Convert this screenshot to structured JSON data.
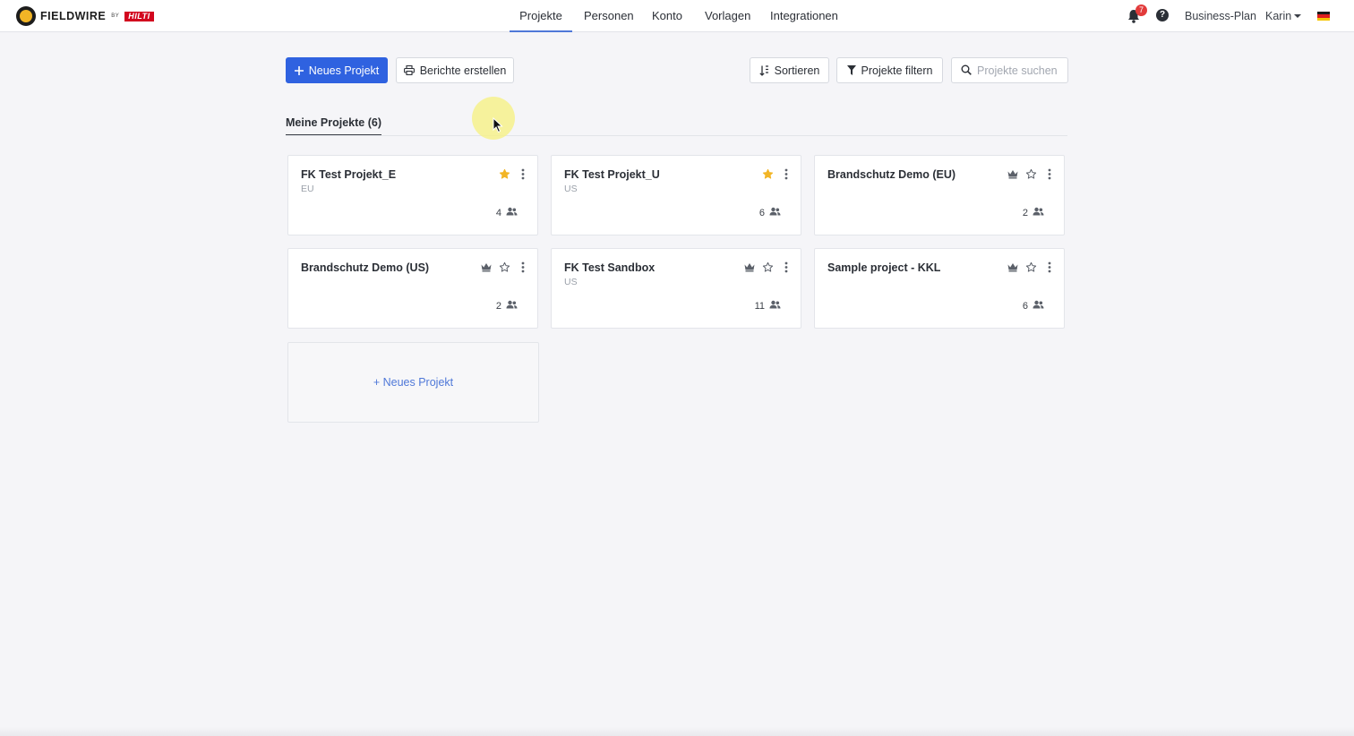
{
  "brand": {
    "name": "FIELDWIRE",
    "by": "BY",
    "partner": "HILTI"
  },
  "nav": {
    "items": [
      {
        "label": "Projekte",
        "active": true
      },
      {
        "label": "Personen",
        "active": false
      },
      {
        "label": "Konto",
        "active": false
      },
      {
        "label": "Vorlagen",
        "active": false
      },
      {
        "label": "Integrationen",
        "active": false
      }
    ]
  },
  "header_right": {
    "notifications_count": "7",
    "help_symbol": "?",
    "plan_label": "Business-Plan",
    "user_name": "Karin",
    "language_flag": "flag-de-icon"
  },
  "toolbar": {
    "new_project_label": "Neues Projekt",
    "reports_label": "Berichte erstellen",
    "sort_label": "Sortieren",
    "filter_label": "Projekte filtern",
    "search_placeholder": "Projekte suchen",
    "search_value": ""
  },
  "tabs": [
    {
      "label": "Meine Projekte (6)",
      "active": true
    }
  ],
  "projects": [
    {
      "name": "FK Test Projekt_E",
      "region": "EU",
      "users": "4",
      "starred": true,
      "owner_crown": false
    },
    {
      "name": "FK Test Projekt_U",
      "region": "US",
      "users": "6",
      "starred": true,
      "owner_crown": false
    },
    {
      "name": "Brandschutz Demo (EU)",
      "region": "",
      "users": "2",
      "starred": false,
      "owner_crown": true
    },
    {
      "name": "Brandschutz Demo (US)",
      "region": "",
      "users": "2",
      "starred": false,
      "owner_crown": true
    },
    {
      "name": "FK Test Sandbox",
      "region": "US",
      "users": "11",
      "starred": false,
      "owner_crown": true
    },
    {
      "name": "Sample project - KKL",
      "region": "",
      "users": "6",
      "starred": false,
      "owner_crown": true
    }
  ],
  "new_project_card_label": "+ Neues Projekt",
  "colors": {
    "primary": "#2f62e0",
    "star_active": "#f2b526",
    "badge": "#e23b3b",
    "link": "#4f78d8",
    "background": "#f5f5f8"
  }
}
